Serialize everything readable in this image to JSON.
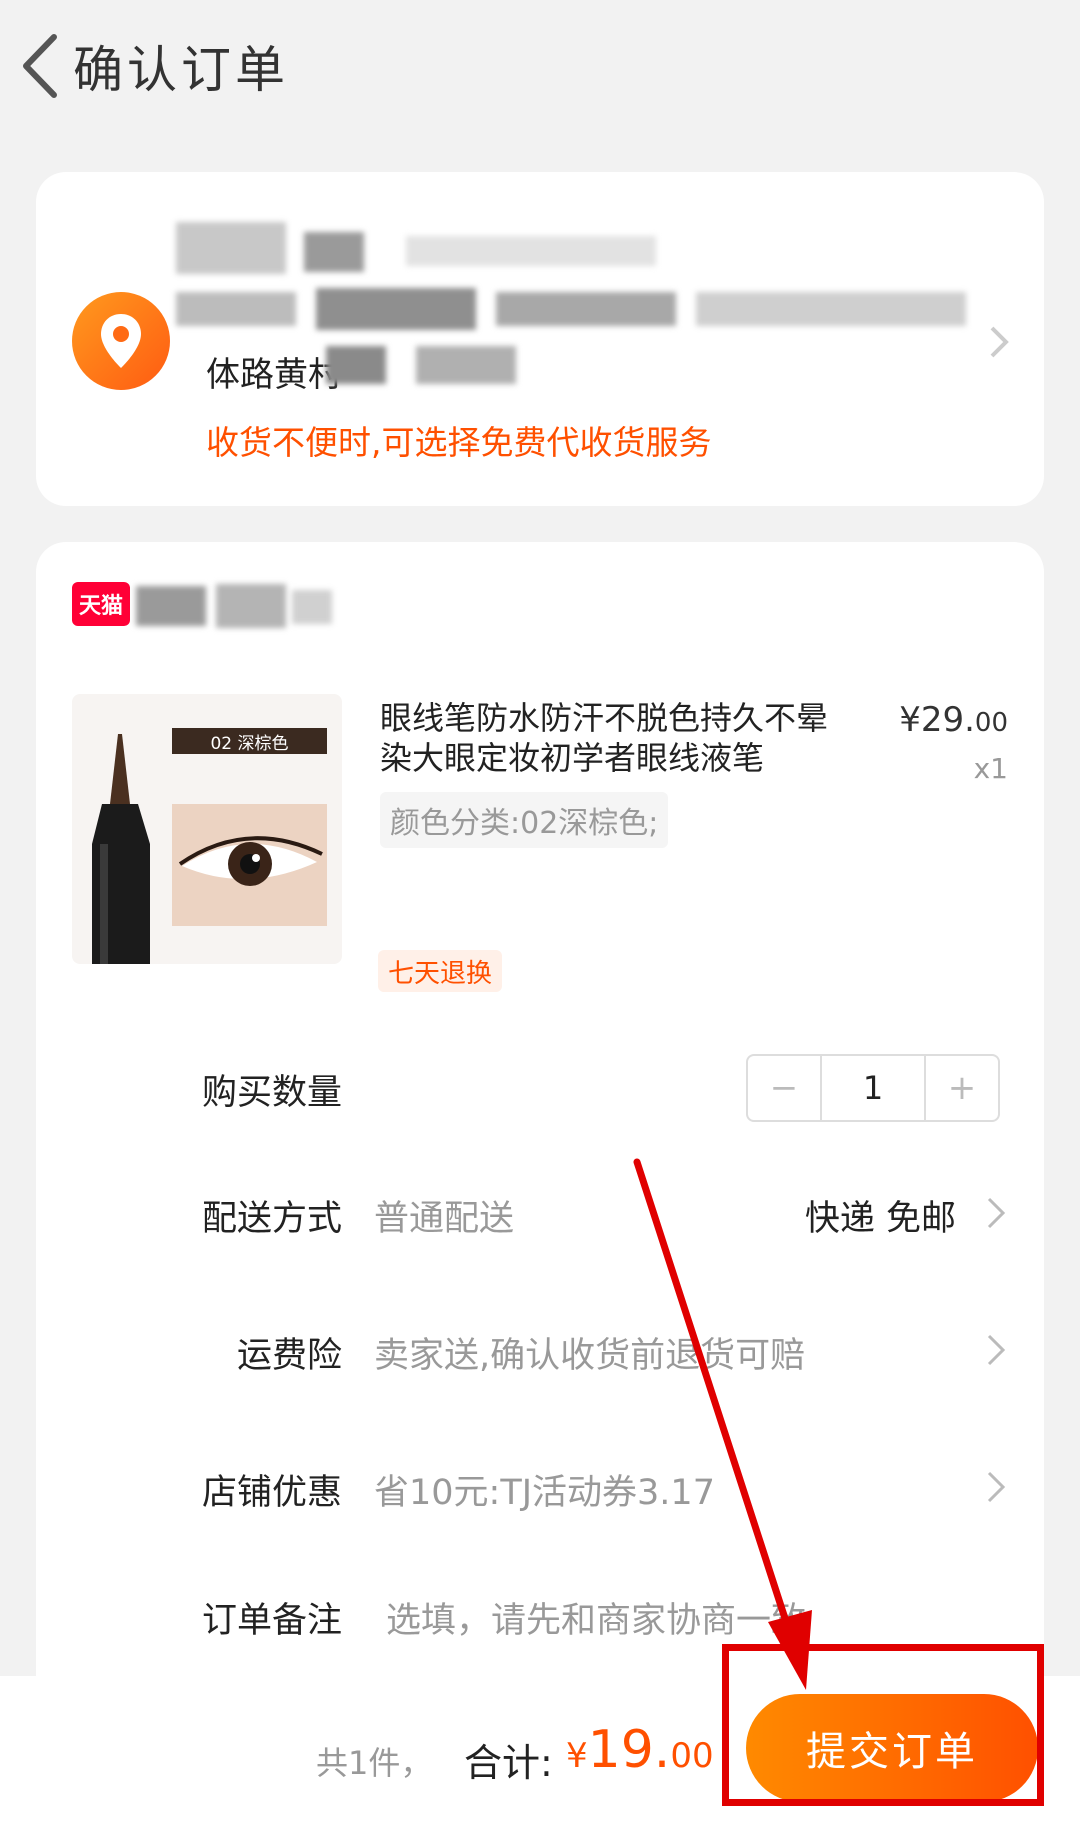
{
  "header": {
    "title": "确认订单"
  },
  "address": {
    "line2": "体路黄村",
    "tip": "收货不便时,可选择免费代收货服务"
  },
  "store": {
    "badge": "天猫"
  },
  "product": {
    "thumb_label": "02 深棕色",
    "title": "眼线笔防水防汗不脱色持久不晕染大眼定妆初学者眼线液笔",
    "price_main": "¥29.",
    "price_decimal": "00",
    "quantity": "x1",
    "sku": "颜色分类:02深棕色;",
    "service_tag": "七天退换"
  },
  "rows": {
    "quantity_label": "购买数量",
    "quantity_value": "1",
    "minus": "−",
    "plus": "+",
    "delivery_label": "配送方式",
    "delivery_value": "普通配送",
    "delivery_right": "快递 免邮",
    "insurance_label": "运费险",
    "insurance_value": "卖家送,确认收货前退货可赔",
    "discount_label": "店铺优惠",
    "discount_value": "省10元:TJ活动券3.17",
    "note_label": "订单备注",
    "note_placeholder": "选填，请先和商家协商一致"
  },
  "footer": {
    "count_text": "共1件，",
    "total_label": "合计:",
    "total_currency": "¥",
    "total_main": "19.",
    "total_decimal": "00",
    "submit": "提交订单"
  },
  "colors": {
    "accent": "#ff5000",
    "annotation": "#e00000"
  }
}
